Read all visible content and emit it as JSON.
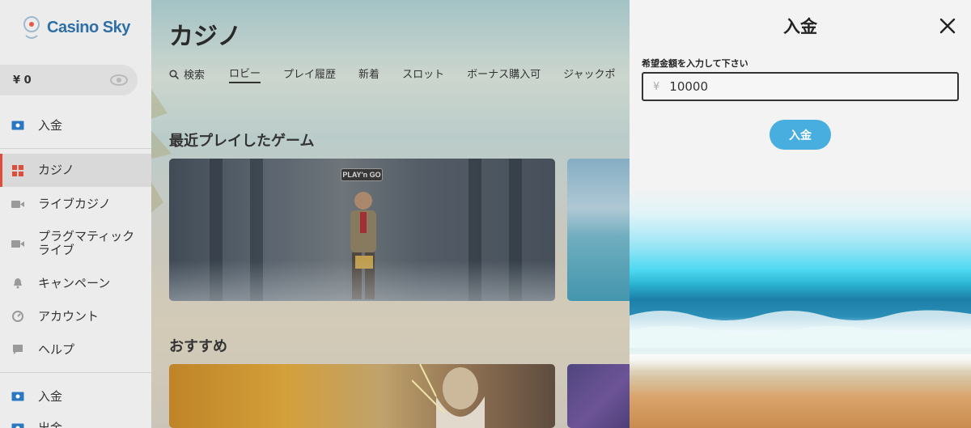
{
  "brand": {
    "name": "Casino Sky"
  },
  "balance": {
    "value": "¥ 0"
  },
  "sidebar": {
    "items": [
      {
        "label": "入金",
        "icon": "cash-icon"
      },
      {
        "label": "カジノ",
        "icon": "grid-icon"
      },
      {
        "label": "ライブカジノ",
        "icon": "video-camera-icon"
      },
      {
        "label": "プラグマティック\nライブ",
        "icon": "video-camera-icon"
      },
      {
        "label": "キャンペーン",
        "icon": "bell-icon"
      },
      {
        "label": "アカウント",
        "icon": "dashboard-icon"
      },
      {
        "label": "ヘルプ",
        "icon": "chat-icon"
      },
      {
        "label": "入金",
        "icon": "cash-icon"
      },
      {
        "label": "出金",
        "icon": "cash-icon"
      }
    ]
  },
  "main": {
    "title": "カジノ",
    "tabs": [
      "検索",
      "ロビー",
      "プレイ履歴",
      "新着",
      "スロット",
      "ボーナス購入可",
      "ジャックポ"
    ],
    "active_tab": "ロビー",
    "sections": {
      "recent": "最近プレイしたゲーム",
      "recommended": "おすすめ"
    },
    "cards": {
      "play_go_logo": "PLAY'n GO"
    }
  },
  "deposit_panel": {
    "title": "入金",
    "field_label": "希望金額を入力して下さい",
    "currency_symbol": "¥",
    "amount": "10000",
    "submit_label": "入金"
  },
  "colors": {
    "accent_blue": "#48aee0",
    "brand_blue": "#2d6fa6",
    "active_marker": "#e04c3a"
  }
}
